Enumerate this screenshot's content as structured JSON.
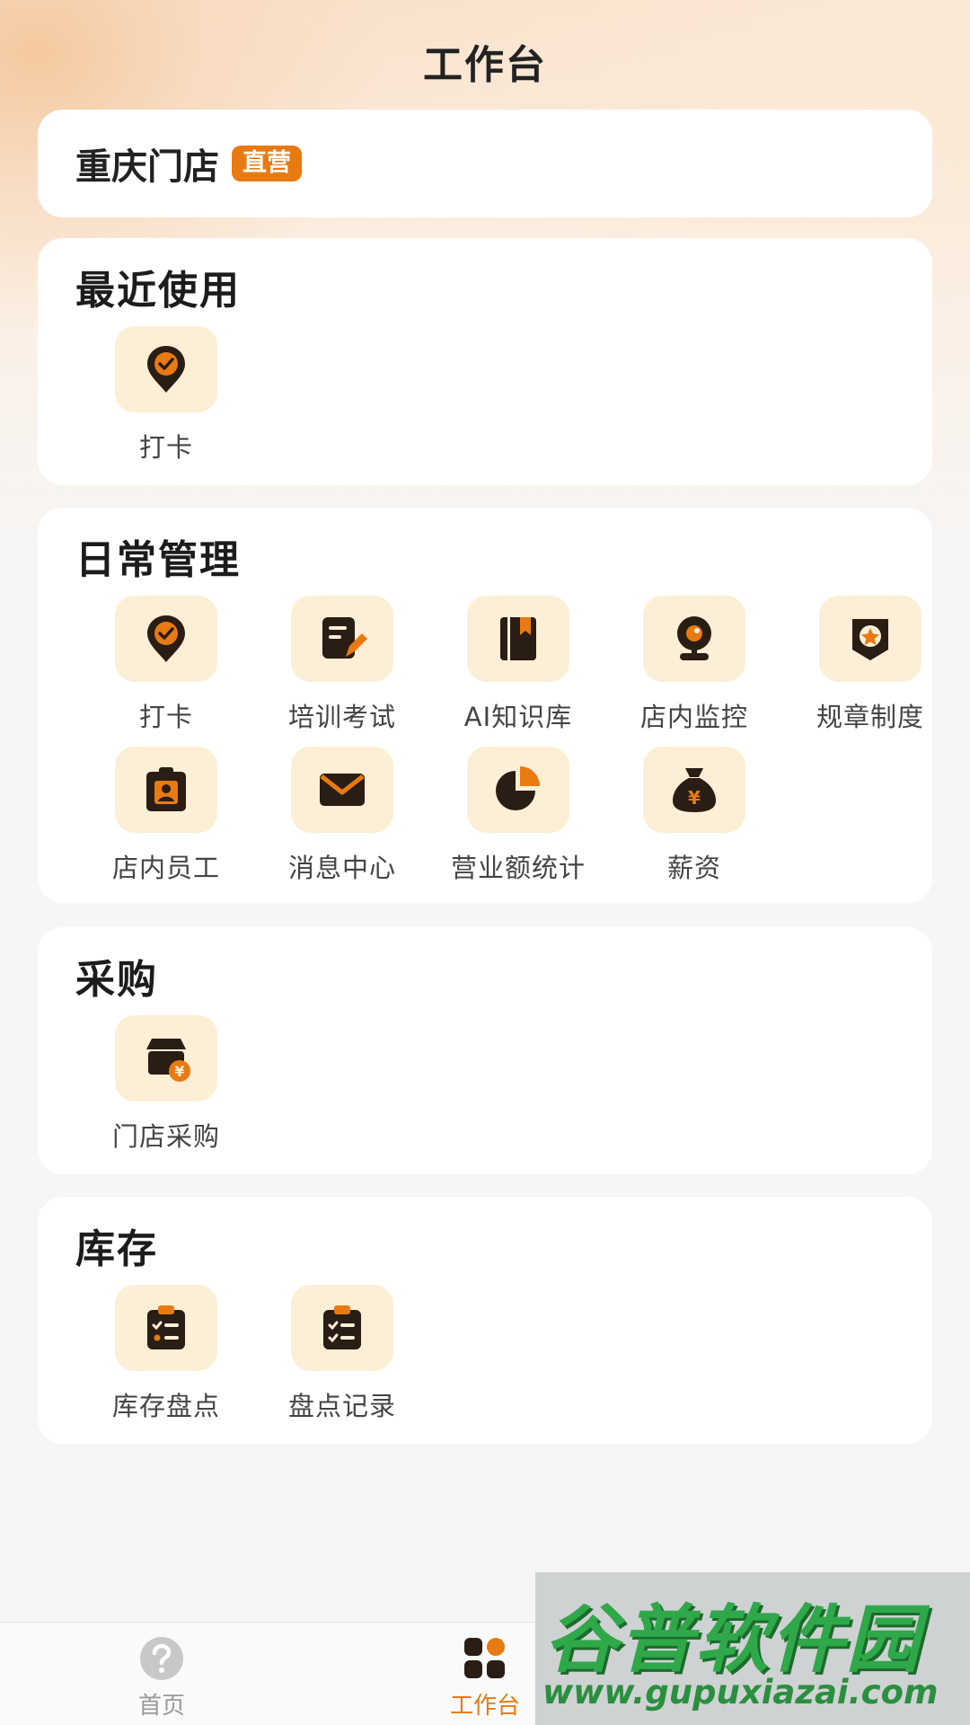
{
  "page": {
    "title": "工作台"
  },
  "store": {
    "name": "重庆门店",
    "badge": "直营"
  },
  "colors": {
    "accent": "#e87a12",
    "icon_bg": "#fdeed6",
    "icon_dark": "#2a1d14"
  },
  "sections": {
    "recent": {
      "title": "最近使用",
      "items": [
        {
          "label": "打卡",
          "icon": "checkin-pin-icon"
        }
      ]
    },
    "daily": {
      "title": "日常管理",
      "items": [
        {
          "label": "打卡",
          "icon": "checkin-pin-icon"
        },
        {
          "label": "培训考试",
          "icon": "exam-edit-icon"
        },
        {
          "label": "AI知识库",
          "icon": "book-icon"
        },
        {
          "label": "店内监控",
          "icon": "camera-icon"
        },
        {
          "label": "规章制度",
          "icon": "badge-star-icon"
        },
        {
          "label": "店内员工",
          "icon": "employee-card-icon"
        },
        {
          "label": "消息中心",
          "icon": "mail-icon"
        },
        {
          "label": "营业额统计",
          "icon": "pie-chart-icon"
        },
        {
          "label": "薪资",
          "icon": "money-bag-icon"
        }
      ]
    },
    "purchase": {
      "title": "采购",
      "items": [
        {
          "label": "门店采购",
          "icon": "store-purchase-icon"
        }
      ]
    },
    "inventory": {
      "title": "库存",
      "items": [
        {
          "label": "库存盘点",
          "icon": "clipboard-check-icon"
        },
        {
          "label": "盘点记录",
          "icon": "clipboard-list-icon"
        }
      ]
    }
  },
  "tabbar": {
    "tabs": [
      {
        "label": "首页",
        "icon": "help-circle-icon",
        "active": false
      },
      {
        "label": "工作台",
        "icon": "grid-apps-icon",
        "active": true
      }
    ]
  },
  "watermark": {
    "title": "谷普软件园",
    "url": "www.gupuxiazai.com"
  }
}
